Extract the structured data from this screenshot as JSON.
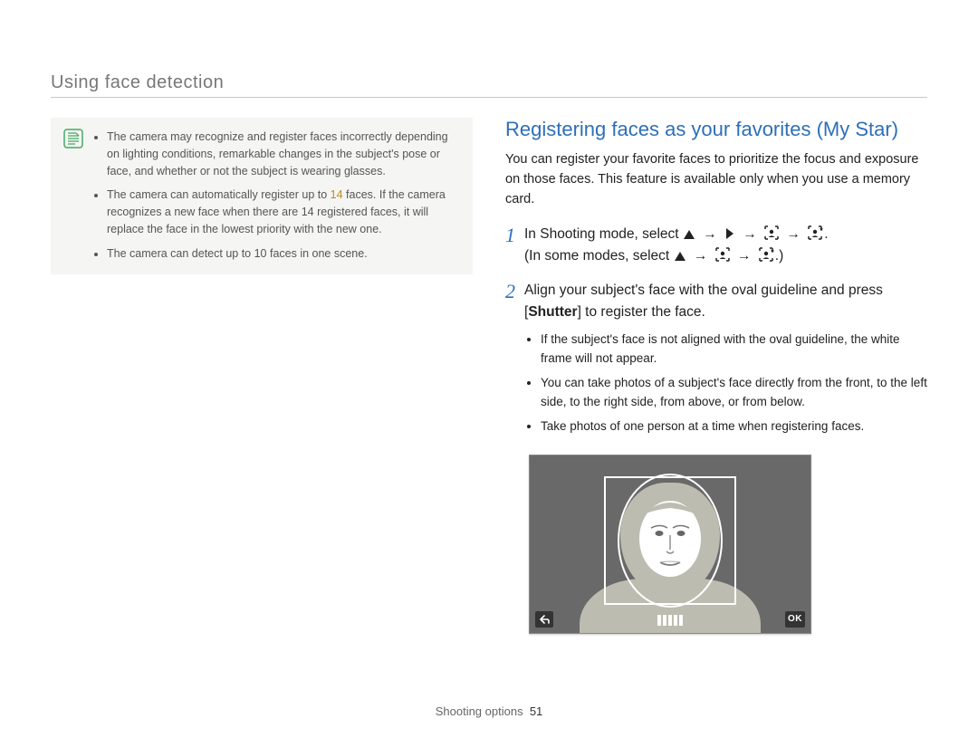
{
  "header": "Using face detection",
  "note": {
    "items": [
      {
        "pre": "The camera may recognize and register faces incorrectly depending on lighting conditions, remarkable changes in the subject's pose or face, and whether or not the subject is wearing glasses."
      },
      {
        "pre": "The camera can automatically register up to ",
        "hl": "14",
        "post": " faces. If the camera recognizes a new face when there are 14 registered faces, it will replace the face in the lowest priority with the new one."
      },
      {
        "pre": "The camera can detect up to 10 faces in one scene."
      }
    ]
  },
  "section": {
    "title": "Registering faces as your favorites (My Star)",
    "intro": "You can register your favorite faces to prioritize the focus and exposure on those faces. This feature is available only when you use a memory card."
  },
  "steps": [
    {
      "num": "1",
      "line1_a": "In Shooting mode, select ",
      "line1_end": ".",
      "line2_a": "(In some modes, select ",
      "line2_end": ".)"
    },
    {
      "num": "2",
      "line1_a": "Align your subject's face with the oval guideline and press [",
      "line1_key": "Shutter",
      "line1_b": "] to register the face.",
      "bullets": [
        "If the subject's face is not aligned with the oval guideline, the white frame will not appear.",
        "You can take photos of a subject's face directly from the front, to the left side, to the right side, from above, or from below.",
        "Take photos of one person at a time when registering faces."
      ]
    }
  ],
  "lcd": {
    "ok": "OK"
  },
  "footer": {
    "section": "Shooting options",
    "page": "51"
  }
}
